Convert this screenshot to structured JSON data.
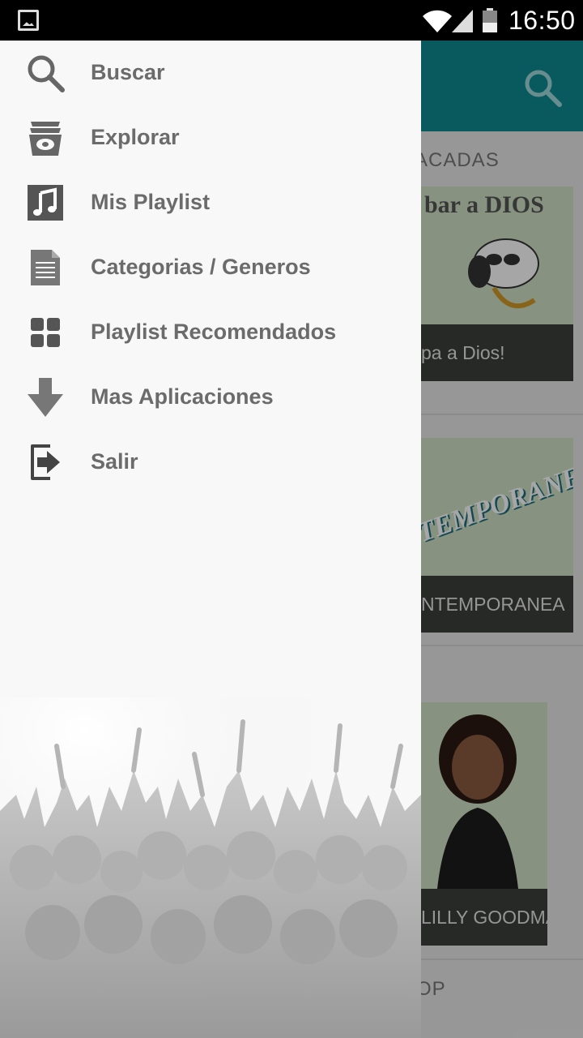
{
  "status_bar": {
    "time": "16:50",
    "icons": [
      "image-notification-icon",
      "wifi-icon",
      "signal-icon",
      "battery-icon"
    ]
  },
  "drawer": {
    "items": [
      {
        "label": "Buscar",
        "icon": "search-icon"
      },
      {
        "label": "Explorar",
        "icon": "explore-icon"
      },
      {
        "label": "Mis Playlist",
        "icon": "music-note-icon"
      },
      {
        "label": "Categorias / Generos",
        "icon": "document-icon"
      },
      {
        "label": "Playlist Recomendados",
        "icon": "grid-icon"
      },
      {
        "label": "Mas Aplicaciones",
        "icon": "download-arrow-icon"
      },
      {
        "label": "Salir",
        "icon": "exit-icon"
      }
    ]
  },
  "background": {
    "section_title_1": "ACADAS",
    "card1_caption": "pa a Dios!",
    "card1_art": "bar a DIOS",
    "card2_caption": "NTEMPORANEA",
    "card3_caption": "LILLY GOODMA",
    "section_title_3": "OP"
  },
  "colors": {
    "toolbar": "#0e8a92",
    "drawer_bg": "#f8f8f8",
    "menu_text": "#6b6b6b"
  }
}
